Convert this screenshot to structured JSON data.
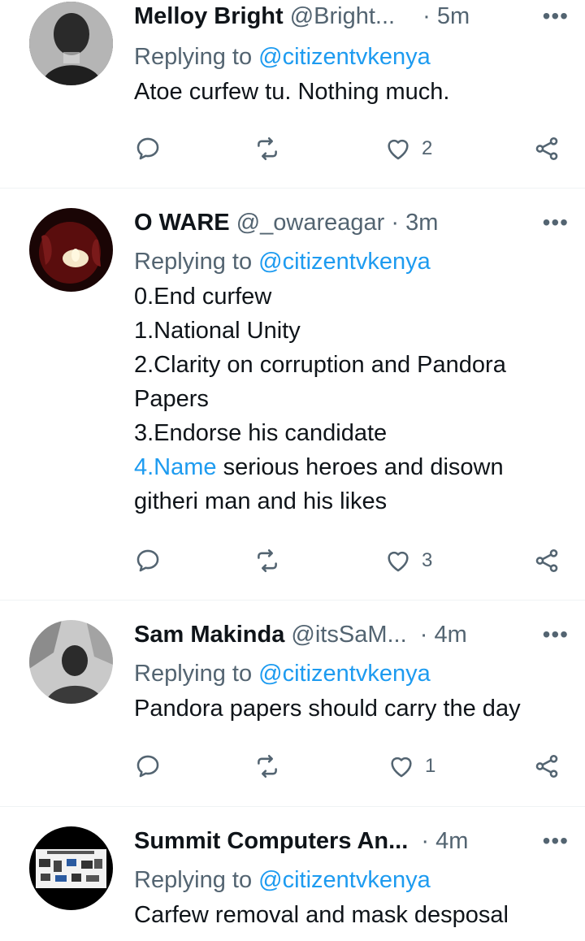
{
  "tweets": [
    {
      "name": "Melloy Bright",
      "handle": "@Bright...",
      "time": "5m",
      "reply_prefix": "Replying to",
      "reply_to": "@citizentvkenya",
      "lines": [
        "Atoe curfew tu. Nothing much."
      ],
      "likes": "2",
      "avatar_icon": "profile-photo"
    },
    {
      "name": "O WARE",
      "handle": "@_owareagar",
      "time": "3m",
      "reply_prefix": "Replying to",
      "reply_to": "@citizentvkenya",
      "lines": [
        "0.End curfew",
        "1.National Unity",
        "2.Clarity on corruption and Pandora",
        "Papers",
        "3.Endorse his candidate"
      ],
      "link_text": "4.Name",
      "link_rest": " serious heroes and disown",
      "last_line": "githeri man and his likes",
      "likes": "3",
      "avatar_icon": "candle-photo"
    },
    {
      "name": "Sam Makinda",
      "handle": "@itsSaM...",
      "time": "4m",
      "reply_prefix": "Replying to",
      "reply_to": "@citizentvkenya",
      "lines": [
        "Pandora papers should carry the day"
      ],
      "likes": "1",
      "avatar_icon": "profile-photo"
    },
    {
      "name": "Summit Computers An...",
      "time": "4m",
      "reply_prefix": "Replying to",
      "reply_to": "@citizentvkenya",
      "lines": [
        "Carfew removal and mask desposal"
      ],
      "avatar_icon": "store-logo"
    }
  ],
  "ui": {
    "dot": "·",
    "more": "•••"
  },
  "colors": {
    "accent": "#1d9bf0",
    "secondary_text": "#536471",
    "primary_text": "#0f1419",
    "divider": "#eff3f4"
  }
}
